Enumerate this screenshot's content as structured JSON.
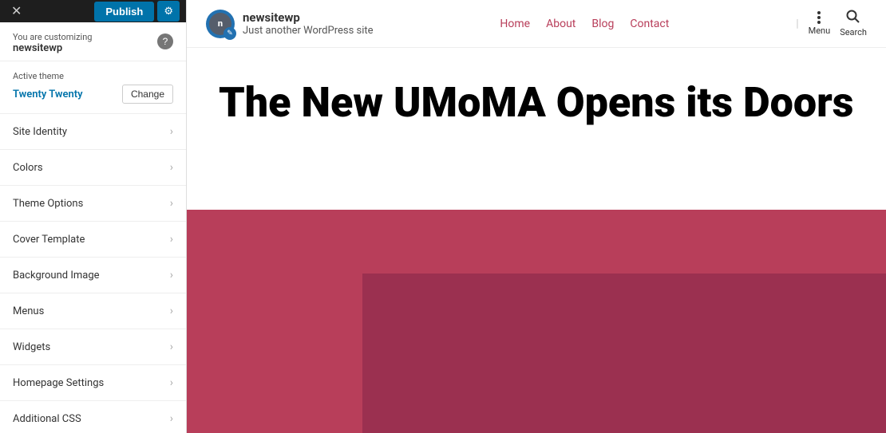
{
  "topbar": {
    "close_icon": "✕",
    "publish_label": "Publish",
    "settings_icon": "⚙"
  },
  "customizing": {
    "label": "You are customizing",
    "site_name": "newsitewp",
    "help_icon": "?"
  },
  "active_theme": {
    "label": "Active theme",
    "theme_name": "Twenty Twenty",
    "change_label": "Change"
  },
  "menu_items": [
    {
      "id": "site-identity",
      "label": "Site Identity"
    },
    {
      "id": "colors",
      "label": "Colors"
    },
    {
      "id": "theme-options",
      "label": "Theme Options"
    },
    {
      "id": "cover-template",
      "label": "Cover Template"
    },
    {
      "id": "background-image",
      "label": "Background Image"
    },
    {
      "id": "menus",
      "label": "Menus"
    },
    {
      "id": "widgets",
      "label": "Widgets"
    },
    {
      "id": "homepage-settings",
      "label": "Homepage Settings"
    },
    {
      "id": "additional-css",
      "label": "Additional CSS"
    }
  ],
  "site": {
    "name": "newsitewp",
    "tagline": "Just another WordPress site"
  },
  "nav": {
    "links": [
      "Home",
      "About",
      "Blog",
      "Contact"
    ],
    "menu_label": "Menu",
    "search_label": "Search"
  },
  "preview": {
    "hero_title": "The New UMoMA Opens its Doors"
  }
}
